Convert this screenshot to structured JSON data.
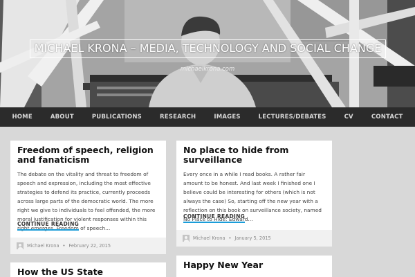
{
  "site": {
    "title": "MICHAEL KRONA – MEDIA, TECHNOLOGY AND SOCIAL CHANGE",
    "subtitle": "michaelkrona.com"
  },
  "nav": {
    "items": [
      "HOME",
      "ABOUT",
      "PUBLICATIONS",
      "RESEARCH",
      "IMAGES",
      "LECTURES/DEBATES",
      "CV",
      "CONTACT"
    ]
  },
  "posts": [
    {
      "title": "Freedom of speech, religion and fanaticism",
      "excerpt": "The debate on the vitality and threat to freedom of speech and expression, including the most effective strategies to defend its practice, currently proceeds across large parts of the democratic world. The more right we give to individuals to feel offended, the more moral justification for violent responses within this right emerges. Freedom of speech…",
      "more": "CONTINUE READING",
      "author": "Michael Krona",
      "separator": "•",
      "date": "February 22, 2015"
    },
    {
      "title": "No place to hide from surveillance",
      "excerpt": "Every once in a while I read books. A rather fair amount to be honest. And last week I finished one I believe could be interesting for others (which is not always the case) So, starting off the new year with a reflection on this book on surveillance society, named No Place to Hide: Edward…",
      "more": "CONTINUE READING",
      "author": "Michael Krona",
      "separator": "•",
      "date": "January 5, 2015"
    },
    {
      "title": "How the US State"
    },
    {
      "title": "Happy New Year"
    }
  ]
}
